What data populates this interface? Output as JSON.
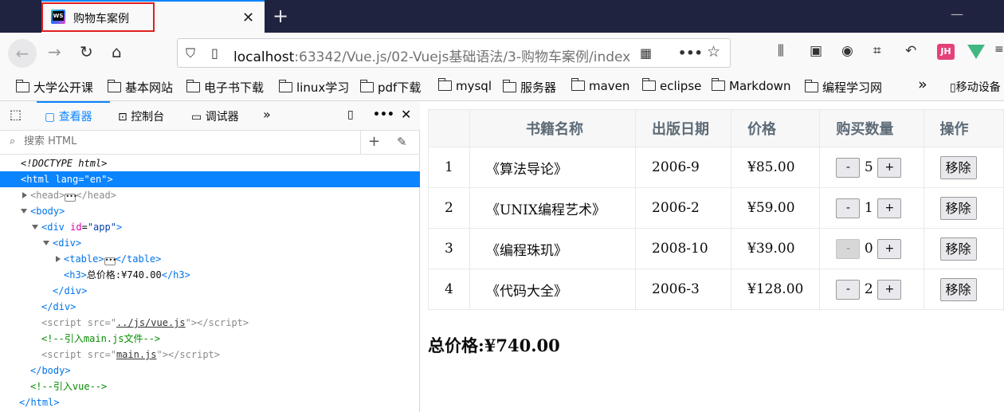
{
  "browser": {
    "tab_title": "购物车案例",
    "url_host": "localhost",
    "url_rest": ":63342/Vue.js/02-Vuejs基础语法/3-购物车案例/index",
    "ext_jh_label": "JH"
  },
  "bookmarks": [
    "大学公开课",
    "基本网站",
    "电子书下载",
    "linux学习",
    "pdf下载",
    "mysql",
    "服务器",
    "maven",
    "eclipse",
    "Markdown",
    "编程学习网"
  ],
  "bookmarks_more": "»",
  "mobile_bookmarks": "移动设备",
  "devtools": {
    "tabs": {
      "inspector": "查看器",
      "console": "控制台",
      "debugger": "调试器"
    },
    "search_placeholder": "搜索 HTML",
    "tree": {
      "doctype": "<!DOCTYPE html>",
      "h3_text": "总价格:¥740.00",
      "script1_src": "../js/vue.js",
      "comment1": "<!--引入main.js文件-->",
      "script2_src": "main.js",
      "comment2": "<!--引入vue-->"
    }
  },
  "cart": {
    "headers": [
      "",
      "书籍名称",
      "出版日期",
      "价格",
      "购买数量",
      "操作"
    ],
    "rows": [
      {
        "id": "1",
        "name": "《算法导论》",
        "date": "2006-9",
        "price": "¥85.00",
        "count": "5"
      },
      {
        "id": "2",
        "name": "《UNIX编程艺术》",
        "date": "2006-2",
        "price": "¥59.00",
        "count": "1"
      },
      {
        "id": "3",
        "name": "《编程珠玑》",
        "date": "2008-10",
        "price": "¥39.00",
        "count": "0"
      },
      {
        "id": "4",
        "name": "《代码大全》",
        "date": "2006-3",
        "price": "¥128.00",
        "count": "2"
      }
    ],
    "minus_label": "-",
    "plus_label": "+",
    "remove_label": "移除",
    "total_label": "总价格",
    "total_value": ":¥740.00"
  }
}
